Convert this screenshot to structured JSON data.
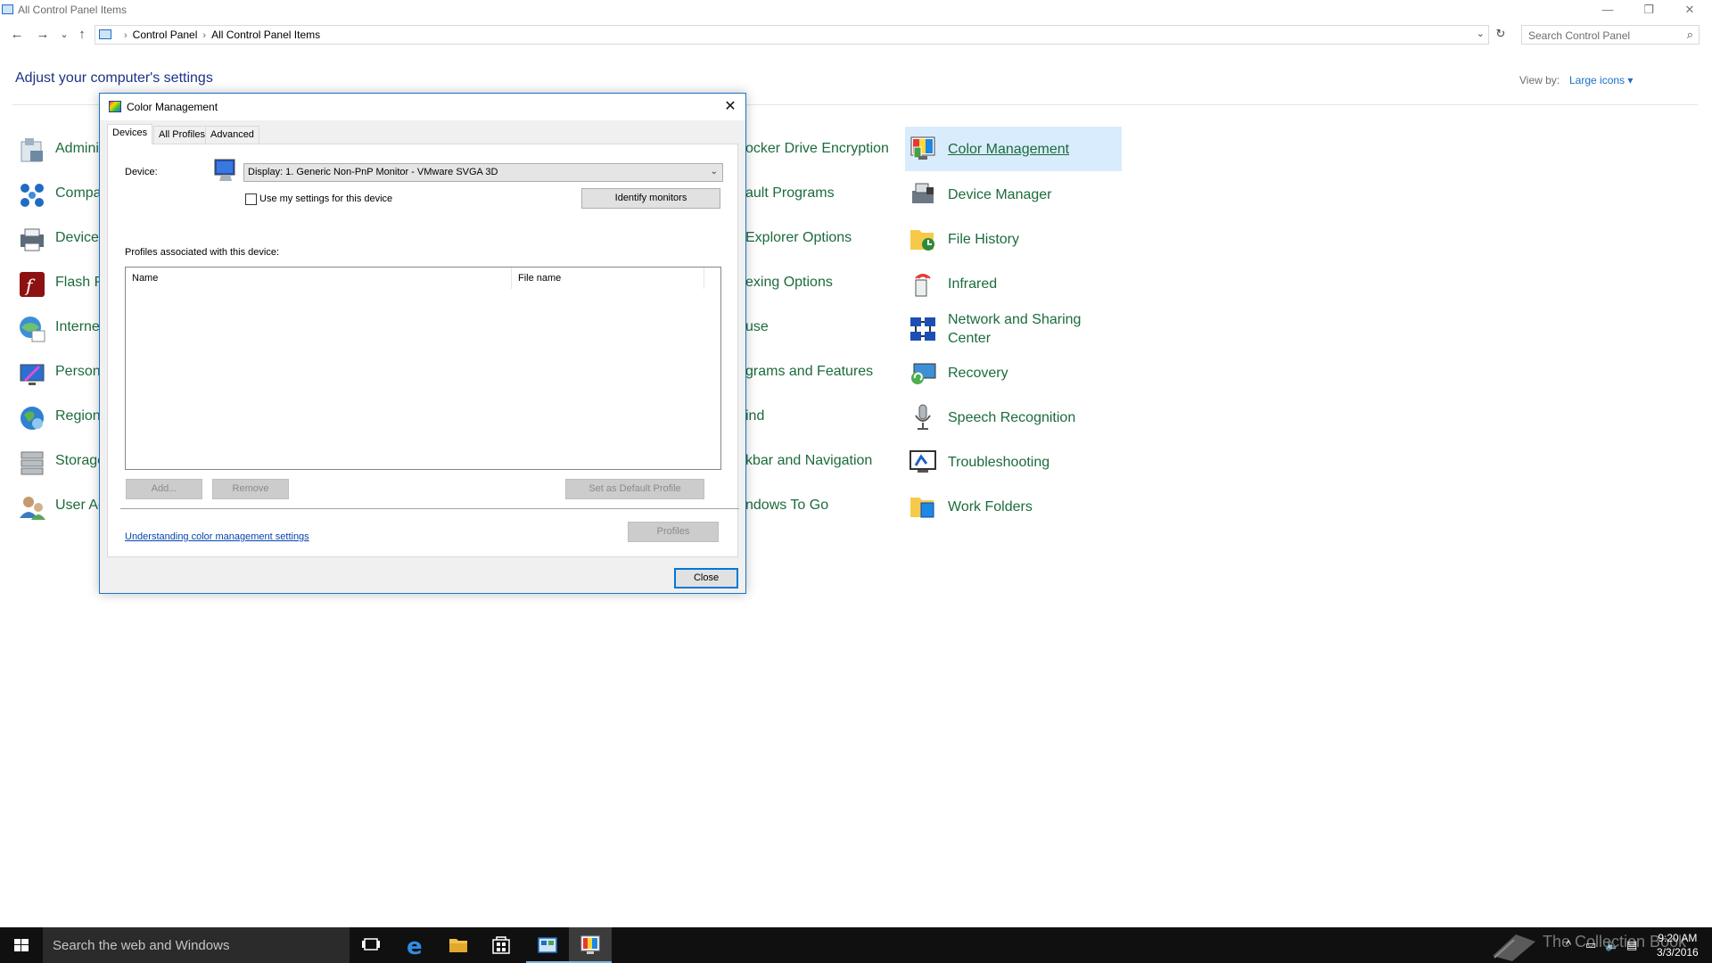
{
  "window": {
    "title": "All Control Panel Items",
    "minimize_glyph": "—",
    "restore_glyph": "❐",
    "close_glyph": "✕"
  },
  "nav": {
    "back_glyph": "←",
    "forward_glyph": "→",
    "recent_glyph": "⌄",
    "up_glyph": "↑",
    "breadcrumb": [
      "Control Panel",
      "All Control Panel Items"
    ],
    "breadcrumb_sep": "›",
    "refresh_glyph": "↻",
    "search_placeholder": "Search Control Panel"
  },
  "header": {
    "heading": "Adjust your computer's settings",
    "view_by_label": "View by:",
    "view_by_value": "Large icons ▾"
  },
  "left_column_partials": [
    "Admini",
    "Compa",
    "Devices",
    "Flash P",
    "Interne",
    "Persona",
    "Region",
    "Storage",
    "User Ac"
  ],
  "middle_column_partials": [
    "ocker Drive Encryption",
    "ault Programs",
    "Explorer Options",
    "exing Options",
    "use",
    "grams and Features",
    "ind",
    "kbar and Navigation",
    "ndows To Go"
  ],
  "right_column_items": [
    {
      "label": "Color Management",
      "icon": "color-management-icon",
      "selected": true
    },
    {
      "label": "Device Manager",
      "icon": "device-manager-icon"
    },
    {
      "label": "File History",
      "icon": "file-history-icon"
    },
    {
      "label": "Infrared",
      "icon": "infrared-icon"
    },
    {
      "label": "Network and Sharing Center",
      "icon": "network-sharing-icon"
    },
    {
      "label": "Recovery",
      "icon": "recovery-icon"
    },
    {
      "label": "Speech Recognition",
      "icon": "microphone-icon"
    },
    {
      "label": "Troubleshooting",
      "icon": "troubleshooting-icon"
    },
    {
      "label": "Work Folders",
      "icon": "work-folders-icon"
    }
  ],
  "dialog": {
    "title": "Color Management",
    "close_glyph": "✕",
    "tabs": [
      "Devices",
      "All Profiles",
      "Advanced"
    ],
    "device_label": "Device:",
    "device_value": "Display: 1. Generic Non-PnP Monitor - VMware SVGA 3D",
    "use_my_settings": "Use my settings for this device",
    "identify_monitors": "Identify monitors",
    "profiles_label": "Profiles associated with this device:",
    "columns": [
      "Name",
      "File name"
    ],
    "add_button": "Add...",
    "remove_button": "Remove",
    "set_default_button": "Set as Default Profile",
    "help_link": "Understanding color management settings",
    "profiles_button": "Profiles",
    "close_button": "Close"
  },
  "taskbar": {
    "search_placeholder": "Search the web and Windows",
    "watermark": "The Collection Book",
    "time": "9:20 AM",
    "date": "3/3/2016",
    "tray_glyphs": [
      "^",
      "▭",
      "🔈",
      "▤"
    ]
  },
  "colors": {
    "item_green": "#1c6b3c",
    "heading_blue": "#1e3287",
    "accent_blue": "#0078d7",
    "selection": "#d9ecfd"
  }
}
